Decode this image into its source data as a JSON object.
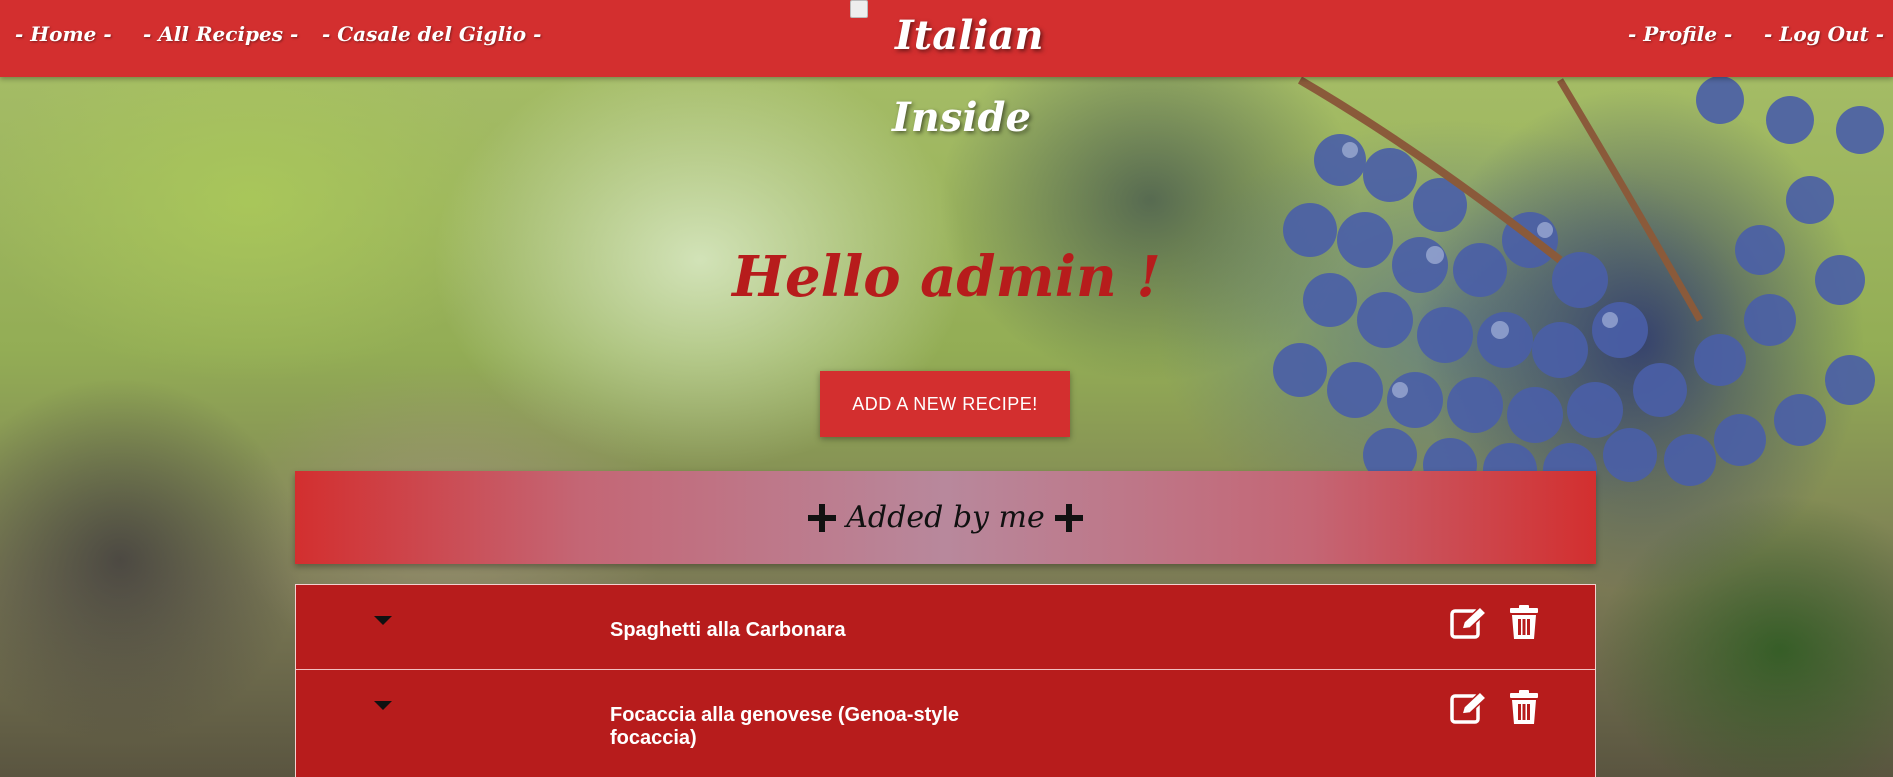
{
  "navbar": {
    "links": [
      "- Home -",
      "- All Recipes -",
      "- Casale del Giglio -",
      "- Profile -",
      "- Log Out -"
    ],
    "brand": {
      "line1": "Italian",
      "line2": "Inside",
      "logo_alt": "broken-image-icon"
    }
  },
  "hero": {
    "greeting": "Hello admin !",
    "add_button": "ADD A NEW RECIPE!"
  },
  "section": {
    "title": "Added by me",
    "recipes": [
      {
        "name": "Spaghetti alla Carbonara"
      },
      {
        "name": "Focaccia alla genovese (Genoa-style focaccia)"
      }
    ]
  },
  "colors": {
    "primary": "#d32f2f",
    "dark_red": "#b71c1c",
    "text_light": "#ffffff"
  }
}
